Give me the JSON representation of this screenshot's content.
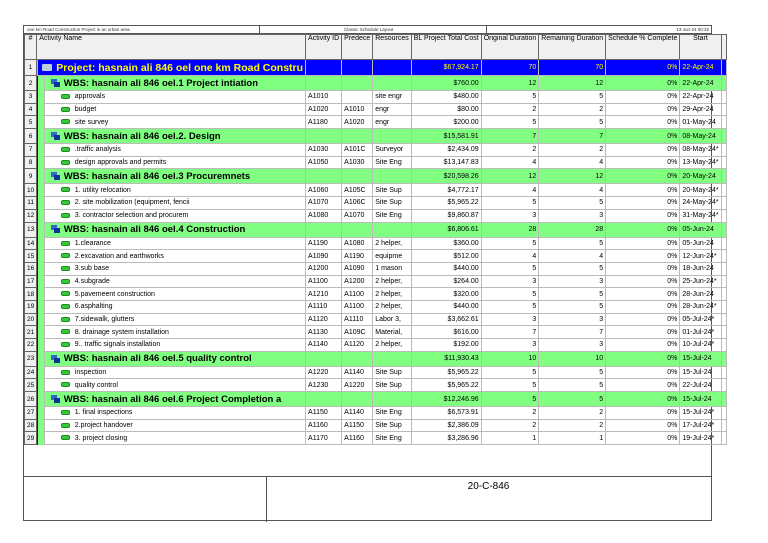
{
  "header": {
    "project_note": "one km Road Construction Project in an urban area.",
    "layout_name": "Classic Schedule Layout",
    "print_date": "13-Jun-24 00:32"
  },
  "columns": [
    "#",
    "Activity Name",
    "Activity ID",
    "Predece",
    "Resources",
    "BL Project Total Cost",
    "Original Duration",
    "Remaining Duration",
    "Schedule % Complete",
    "Start"
  ],
  "rows": [
    {
      "n": "1",
      "type": "proj",
      "name": "Project: hasnain ali 846 oel  one km Road Constru",
      "id": "",
      "pred": "",
      "res": "",
      "cost": "$67,924.17",
      "od": "70",
      "rd": "70",
      "pc": "0%",
      "start": "22-Apr-24"
    },
    {
      "n": "2",
      "type": "wbs",
      "name": "WBS: hasnain ali 846 oel.1  Project intiation",
      "id": "",
      "pred": "",
      "res": "",
      "cost": "$760.00",
      "od": "12",
      "rd": "12",
      "pc": "0%",
      "start": "22-Apr-24"
    },
    {
      "n": "3",
      "type": "task",
      "name": "approvals",
      "id": "A1010",
      "pred": "",
      "res": "site engr",
      "cost": "$480.00",
      "od": "5",
      "rd": "5",
      "pc": "0%",
      "start": "22-Apr-24"
    },
    {
      "n": "4",
      "type": "task",
      "name": "budget",
      "id": "A1020",
      "pred": "A1010",
      "res": "engr",
      "cost": "$80.00",
      "od": "2",
      "rd": "2",
      "pc": "0%",
      "start": "29-Apr-24"
    },
    {
      "n": "5",
      "type": "task",
      "name": "site survey",
      "id": "A1180",
      "pred": "A1020",
      "res": "engr",
      "cost": "$200.00",
      "od": "5",
      "rd": "5",
      "pc": "0%",
      "start": "01-May-24"
    },
    {
      "n": "6",
      "type": "wbs",
      "name": "WBS: hasnain ali 846 oel.2.  Design",
      "id": "",
      "pred": "",
      "res": "",
      "cost": "$15,581.91",
      "od": "7",
      "rd": "7",
      "pc": "0%",
      "start": "08-May-24"
    },
    {
      "n": "7",
      "type": "task",
      "name": ".traffic analysis",
      "id": "A1030",
      "pred": "A101C",
      "res": "Surveyor",
      "cost": "$2,434.09",
      "od": "2",
      "rd": "2",
      "pc": "0%",
      "start": "08-May-24*"
    },
    {
      "n": "8",
      "type": "task",
      "name": "design approvals and permits",
      "id": "A1050",
      "pred": "A1030",
      "res": "Site Eng",
      "cost": "$13,147.83",
      "od": "4",
      "rd": "4",
      "pc": "0%",
      "start": "13-May-24*"
    },
    {
      "n": "9",
      "type": "wbs",
      "name": "WBS: hasnain ali 846 oel.3  Procuremnets",
      "id": "",
      "pred": "",
      "res": "",
      "cost": "$20,598.26",
      "od": "12",
      "rd": "12",
      "pc": "0%",
      "start": "20-May-24"
    },
    {
      "n": "10",
      "type": "task",
      "name": "1. utility relocation",
      "id": "A1060",
      "pred": "A105C",
      "res": "Site Sup",
      "cost": "$4,772.17",
      "od": "4",
      "rd": "4",
      "pc": "0%",
      "start": "20-May-24*"
    },
    {
      "n": "11",
      "type": "task",
      "name": "2. site mobilization (equipment, fencii",
      "id": "A1070",
      "pred": "A106C",
      "res": "Site Sup",
      "cost": "$5,965.22",
      "od": "5",
      "rd": "5",
      "pc": "0%",
      "start": "24-May-24*"
    },
    {
      "n": "12",
      "type": "task",
      "name": "3. contractor selection and procurem",
      "id": "A1080",
      "pred": "A1070",
      "res": "Site Eng",
      "cost": "$9,860.87",
      "od": "3",
      "rd": "3",
      "pc": "0%",
      "start": "31-May-24*"
    },
    {
      "n": "13",
      "type": "wbs",
      "name": "WBS: hasnain ali 846 oel.4  Construction",
      "id": "",
      "pred": "",
      "res": "",
      "cost": "$6,806.61",
      "od": "28",
      "rd": "28",
      "pc": "0%",
      "start": "05-Jun-24"
    },
    {
      "n": "14",
      "type": "task",
      "name": "1.clearance",
      "id": "A1190",
      "pred": "A1080",
      "res": "2 helper,",
      "cost": "$360.00",
      "od": "5",
      "rd": "5",
      "pc": "0%",
      "start": "05-Jun-24"
    },
    {
      "n": "15",
      "type": "task",
      "name": "2.excavation and earthworks",
      "id": "A1090",
      "pred": "A1190",
      "res": "equipme",
      "cost": "$512.00",
      "od": "4",
      "rd": "4",
      "pc": "0%",
      "start": "12-Jun-24*"
    },
    {
      "n": "16",
      "type": "task",
      "name": "3.sub base",
      "id": "A1200",
      "pred": "A1090",
      "res": "1 mason",
      "cost": "$440.00",
      "od": "5",
      "rd": "5",
      "pc": "0%",
      "start": "18-Jun-24"
    },
    {
      "n": "17",
      "type": "task",
      "name": "4.subgrade",
      "id": "A1100",
      "pred": "A1200",
      "res": "2 helper,",
      "cost": "$264.00",
      "od": "3",
      "rd": "3",
      "pc": "0%",
      "start": "25-Jun-24*"
    },
    {
      "n": "18",
      "type": "task",
      "name": "5.pavemeent construction",
      "id": "A1210",
      "pred": "A1100",
      "res": "2 helper,",
      "cost": "$320.00",
      "od": "5",
      "rd": "5",
      "pc": "0%",
      "start": "28-Jun-24"
    },
    {
      "n": "19",
      "type": "task",
      "name": "6.asphalting",
      "id": "A1110",
      "pred": "A1100",
      "res": "2 helper,",
      "cost": "$440.00",
      "od": "5",
      "rd": "5",
      "pc": "0%",
      "start": "28-Jun-24*"
    },
    {
      "n": "20",
      "type": "task",
      "name": "7.sidewalk, glutters",
      "id": "A1120",
      "pred": "A1110",
      "res": "Labor 3,",
      "cost": "$3,662.61",
      "od": "3",
      "rd": "3",
      "pc": "0%",
      "start": "05-Jul-24*"
    },
    {
      "n": "21",
      "type": "task",
      "name": "8. drainage system installation",
      "id": "A1130",
      "pred": "A109C",
      "res": "Material,",
      "cost": "$616.00",
      "od": "7",
      "rd": "7",
      "pc": "0%",
      "start": "01-Jul-24*"
    },
    {
      "n": "22",
      "type": "task",
      "name": "9.. traffic signals installation",
      "id": "A1140",
      "pred": "A1120",
      "res": "2 helper,",
      "cost": "$192.00",
      "od": "3",
      "rd": "3",
      "pc": "0%",
      "start": "10-Jul-24*"
    },
    {
      "n": "23",
      "type": "wbs",
      "name": "WBS: hasnain ali 846 oel.5  quality control",
      "id": "",
      "pred": "",
      "res": "",
      "cost": "$11,930.43",
      "od": "10",
      "rd": "10",
      "pc": "0%",
      "start": "15-Jul-24"
    },
    {
      "n": "24",
      "type": "task",
      "name": "inspection",
      "id": "A1220",
      "pred": "A1140",
      "res": "Site Sup",
      "cost": "$5,965.22",
      "od": "5",
      "rd": "5",
      "pc": "0%",
      "start": "15-Jul-24"
    },
    {
      "n": "25",
      "type": "task",
      "name": "quality control",
      "id": "A1230",
      "pred": "A1220",
      "res": "Site Sup",
      "cost": "$5,965.22",
      "od": "5",
      "rd": "5",
      "pc": "0%",
      "start": "22-Jul-24"
    },
    {
      "n": "26",
      "type": "wbs",
      "name": "WBS: hasnain ali 846 oel.6  Project Completion a",
      "id": "",
      "pred": "",
      "res": "",
      "cost": "$12,246.96",
      "od": "5",
      "rd": "5",
      "pc": "0%",
      "start": "15-Jul-24"
    },
    {
      "n": "27",
      "type": "task",
      "name": "1. final inspections",
      "id": "A1150",
      "pred": "A1140",
      "res": "Site Eng",
      "cost": "$6,573.91",
      "od": "2",
      "rd": "2",
      "pc": "0%",
      "start": "15-Jul-24*"
    },
    {
      "n": "28",
      "type": "task",
      "name": "2.project handover",
      "id": "A1160",
      "pred": "A1150",
      "res": "Site Sup",
      "cost": "$2,386.09",
      "od": "2",
      "rd": "2",
      "pc": "0%",
      "start": "17-Jul-24*"
    },
    {
      "n": "29",
      "type": "task",
      "name": "3. project closing",
      "id": "A1170",
      "pred": "A1160",
      "res": "Site Eng",
      "cost": "$3,286.96",
      "od": "1",
      "rd": "1",
      "pc": "0%",
      "start": "19-Jul-24*"
    }
  ],
  "footer": {
    "code": "20-C-846"
  }
}
